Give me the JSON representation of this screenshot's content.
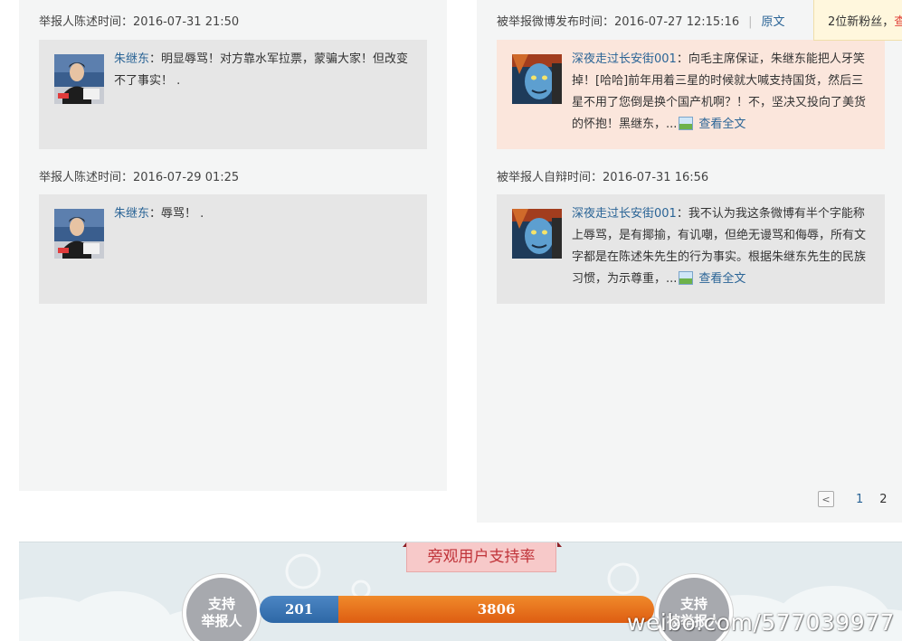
{
  "left_column": {
    "entries": [
      {
        "meta_label": "举报人陈述时间：",
        "meta_time": "2016-07-31 21:50",
        "user": "朱继东",
        "text_line1": "：明显辱骂！对方靠水军拉票，蒙骗大家！但改变",
        "text_line2": "不了事实！ ."
      },
      {
        "meta_label": "举报人陈述时间：",
        "meta_time": "2016-07-29 01:25",
        "user": "朱继东",
        "text_line1": "：辱骂！ ."
      }
    ]
  },
  "right_column": {
    "entries": [
      {
        "meta_label": "被举报微博发布时间：",
        "meta_time": "2016-07-27 12:15:16",
        "meta_link": "原文",
        "user": "深夜走过长安街001",
        "lines": [
          "：向毛主席保证，朱继东能把人牙笑",
          "掉！[哈哈]前年用着三星的时候就大喊支持国货，然后三",
          "星不用了您倒是换个国产机啊？！不，坚决又投向了美货",
          "的怀抱！黑继东，..."
        ],
        "read_more": "查看全文"
      },
      {
        "meta_label": "被举报人自辩时间：",
        "meta_time": "2016-07-31 16:56",
        "user": "深夜走过长安街001",
        "lines": [
          "：我不认为我这条微博有半个字能称",
          "上辱骂，是有揶揄，有讥嘲，但绝无谩骂和侮辱，所有文",
          "字都是在陈述朱先生的行为事实。根据朱继东先生的民族",
          "习惯，为示尊重，..."
        ],
        "read_more": "查看全文"
      }
    ],
    "pagination": {
      "prev": "<",
      "pages": [
        "1",
        "2"
      ]
    }
  },
  "notice": {
    "text": "2位新粉丝，",
    "link": "查"
  },
  "support_rate": {
    "title": "旁观用户支持率",
    "left_label_line1": "支持",
    "left_label_line2": "举报人",
    "right_label_line1": "支持",
    "right_label_line2": "被举报人",
    "reporter_count": "201",
    "reported_count": "3806",
    "reporter_share": 0.05,
    "colors": {
      "reporter": "#2d67a6",
      "reported": "#e8721c"
    }
  },
  "watermark": "weibo.com/577039977"
}
